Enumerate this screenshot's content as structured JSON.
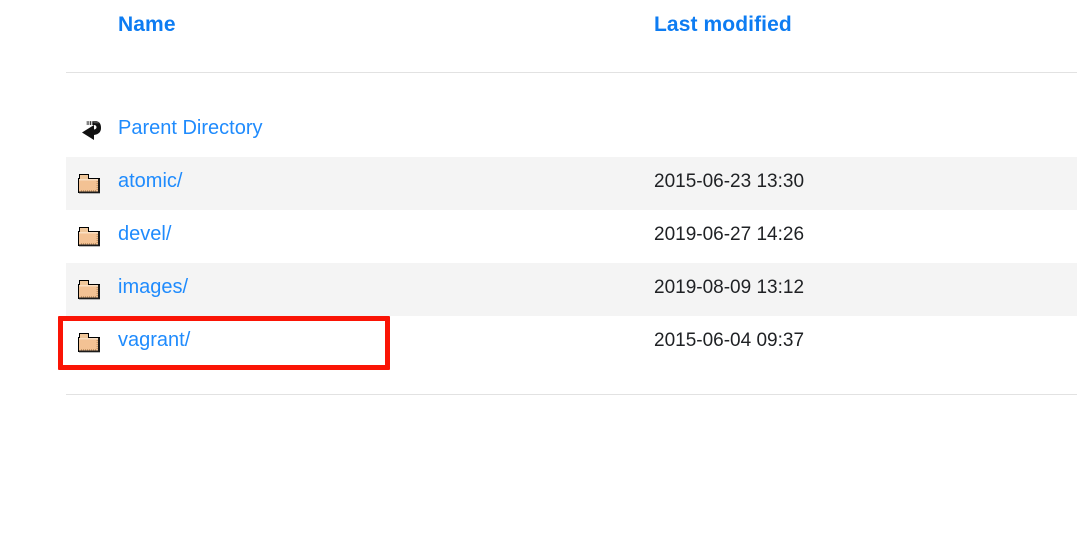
{
  "page": {
    "type": "apache-directory-index",
    "link_color": "#1f8bfd",
    "header_color": "#0d7cf2",
    "text_color": "#1f2124",
    "stripe_color": "#f4f4f4",
    "rule_color": "#e2e2e2",
    "highlight_color": "#fa1405"
  },
  "table": {
    "columns": [
      {
        "key": "name",
        "label": "Name"
      },
      {
        "key": "last_modified",
        "label": "Last modified"
      }
    ],
    "rows": [
      {
        "name": "Parent Directory",
        "icon": "back-arrow-icon",
        "last_modified": "",
        "striped": false,
        "highlighted": false
      },
      {
        "name": "atomic/",
        "icon": "folder-icon",
        "last_modified": "2015-06-23 13:30",
        "striped": true,
        "highlighted": false
      },
      {
        "name": "devel/",
        "icon": "folder-icon",
        "last_modified": "2019-06-27 14:26",
        "striped": false,
        "highlighted": false
      },
      {
        "name": "images/",
        "icon": "folder-icon",
        "last_modified": "2019-08-09 13:12",
        "striped": true,
        "highlighted": false
      },
      {
        "name": "vagrant/",
        "icon": "folder-icon",
        "last_modified": "2015-06-04 09:37",
        "striped": false,
        "highlighted": true
      }
    ]
  }
}
